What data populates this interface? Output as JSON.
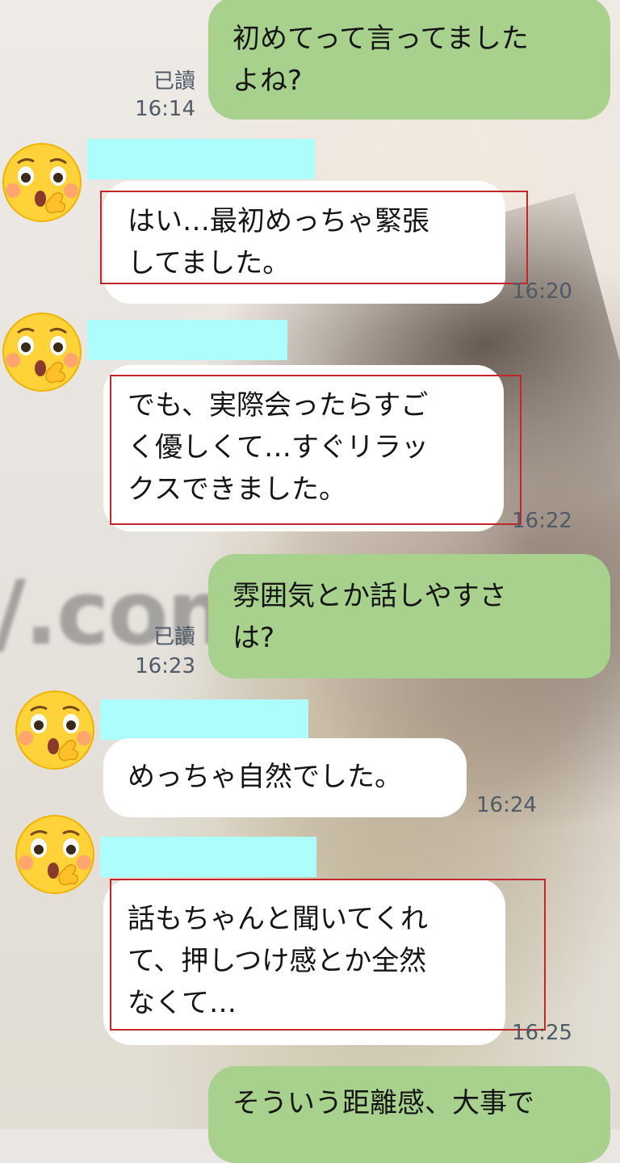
{
  "messages": [
    {
      "sender": "me",
      "text": "初めてって言ってました\nよね?",
      "read": "已讀",
      "time": "16:14"
    },
    {
      "sender": "other",
      "avatar": "thinking-face-emoji",
      "text": "はい…最初めっちゃ緊張\nしてました。",
      "time": "16:20"
    },
    {
      "sender": "other",
      "avatar": "thinking-face-emoji",
      "text": "でも、実際会ったらすご\nく優しくて…すぐリラッ\nクスできました。",
      "time": "16:22"
    },
    {
      "sender": "me",
      "text": "雰囲気とか話しやすさ\nは?",
      "read": "已讀",
      "time": "16:23"
    },
    {
      "sender": "other",
      "avatar": "thinking-face-emoji",
      "text": "めっちゃ自然でした。",
      "time": "16:24"
    },
    {
      "sender": "other",
      "avatar": "thinking-face-emoji",
      "text": "話もちゃんと聞いてくれ\nて、押しつけ感とか全然\nなくて…",
      "time": "16:25"
    },
    {
      "sender": "me",
      "text": "そういう距離感、大事で"
    }
  ],
  "watermark": "/.com",
  "colors": {
    "outgoing_bubble": "#a9d18e",
    "incoming_bubble": "#ffffff",
    "highlight_box": "#c0262a",
    "name_redaction": "#aefdfd",
    "meta_text": "#4e5a68"
  }
}
